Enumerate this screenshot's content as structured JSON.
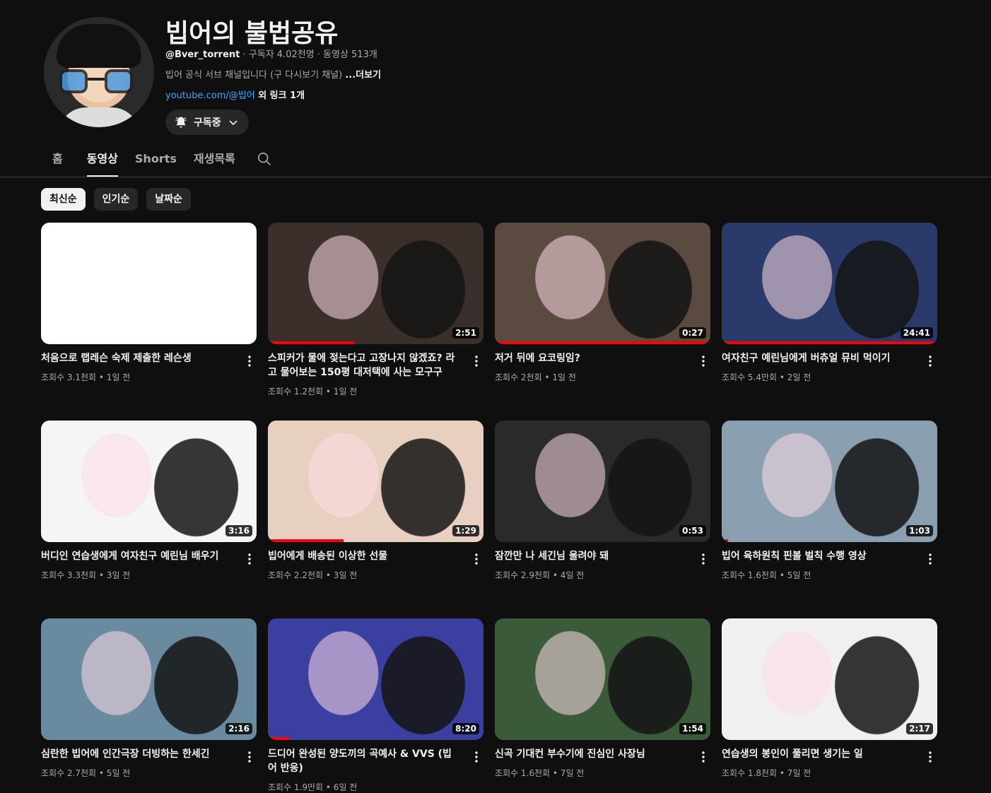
{
  "channel": {
    "title": "빕어의 불법공유",
    "handle": "@Bver_torrent",
    "stats": " · 구독자 4.02천명 · 동영상 513개",
    "description": "빕어 공식 서브 채널입니다 (구 다시보기 채널) ",
    "more": "...더보기",
    "link": "youtube.com/@빕어",
    "link_extra": " 외 링크 1개",
    "subscribe_label": "구독중"
  },
  "tabs": [
    "홈",
    "동영상",
    "Shorts",
    "재생목록"
  ],
  "chips": [
    "최신순",
    "인기순",
    "날짜순"
  ],
  "videos": [
    {
      "title": "처음으로 랩레슨 숙제 제출한 레슨생",
      "meta": "조회수 3.1천회 • 1일 전",
      "duration": "",
      "progress": 0
    },
    {
      "title": "스피커가 물에 젖는다고 고장나지 않겠죠? 라고 물어보는 150평 대저택에 사는 모구구",
      "meta": "조회수 1.2천회 • 1일 전",
      "duration": "2:51",
      "progress": 0.4
    },
    {
      "title": "저거 뒤에 요코링임?",
      "meta": "조회수 2천회 • 1일 전",
      "duration": "0:27",
      "progress": 1.0
    },
    {
      "title": "여자친구 예린님에게 버츄얼 뮤비 먹이기",
      "meta": "조회수 5.4만회 • 2일 전",
      "duration": "24:41",
      "progress": 1.0
    },
    {
      "title": "버디인 연습생에게 여자친구 예린님 배우기",
      "meta": "조회수 3.3천회 • 3일 전",
      "duration": "3:16",
      "progress": 0
    },
    {
      "title": "빕어에게 배송된 이상한 선물",
      "meta": "조회수 2.2천회 • 3일 전",
      "duration": "1:29",
      "progress": 0.35
    },
    {
      "title": "잠깐만 나 세긴님 울려야 돼",
      "meta": "조회수 2.9천회 • 4일 전",
      "duration": "0:53",
      "progress": 0
    },
    {
      "title": "빕어 육하원칙 핀볼 벌칙 수행 영상",
      "meta": "조회수 1.6천회 • 5일 전",
      "duration": "1:03",
      "progress": 0.03
    },
    {
      "title": "심란한 빕어에 인간극장 더빙하는 한세긴",
      "meta": "조회수 2.7천회 • 5일 전",
      "duration": "2:16",
      "progress": 0
    },
    {
      "title": "드디어 완성된 양도끼의 곡예사 & VVS (빕어 반응)",
      "meta": "조회수 1.9만회 • 6일 전",
      "duration": "8:20",
      "progress": 0.1
    },
    {
      "title": "신곡 기대컨 부수기에 진심인 사장님",
      "meta": "조회수 1.6천회 • 7일 전",
      "duration": "1:54",
      "progress": 0
    },
    {
      "title": "연습생의 봉인이 풀리면 생기는 일",
      "meta": "조회수 1.8천회 • 7일 전",
      "duration": "2:17",
      "progress": 0
    }
  ],
  "thumb_colors": [
    "#ffffff",
    "#3a2f2a",
    "#5a4a40",
    "#2a3a6a",
    "#f5f5f5",
    "#e8d0c0",
    "#2a2a2a",
    "#8aa0b0",
    "#6a8aa0",
    "#3a3fa0",
    "#3a5a3a",
    "#f0f0f0"
  ],
  "accent": "#ff0000",
  "link_color": "#3ea6ff"
}
